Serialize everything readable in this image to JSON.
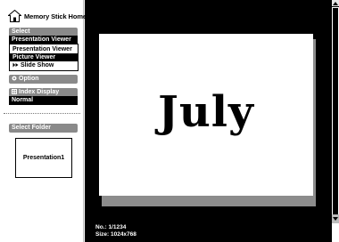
{
  "header": {
    "title": "Memory Stick Home",
    "icon": "home-icon"
  },
  "select_section": {
    "heading": "Select",
    "current_value": "Presentation Viewer",
    "options": [
      {
        "label": "Presentation Viewer",
        "active": false,
        "icon": null
      },
      {
        "label": "Picture Viewer",
        "active": true,
        "icon": null
      },
      {
        "label": "Slide Show",
        "active": false,
        "icon": "slideshow-icon"
      }
    ]
  },
  "option_section": {
    "label": "Option",
    "icon": "option-icon"
  },
  "index_section": {
    "label": "Index Display",
    "value": "Normal",
    "icon": "index-display-icon"
  },
  "folder_section": {
    "heading": "Select Folder",
    "folders": [
      "Presentation1"
    ]
  },
  "preview": {
    "slide_title": "July",
    "info": {
      "number": "No.: 1/1234",
      "size": "Size: 1024x768"
    }
  },
  "colors": {
    "sidebar_bg": "#ffffff",
    "section_header": "#8a8a8a",
    "selection": "#000000",
    "preview_bg": "#000000",
    "slide_bg": "#ffffff",
    "slide_shadow": "#8c8c8c"
  }
}
